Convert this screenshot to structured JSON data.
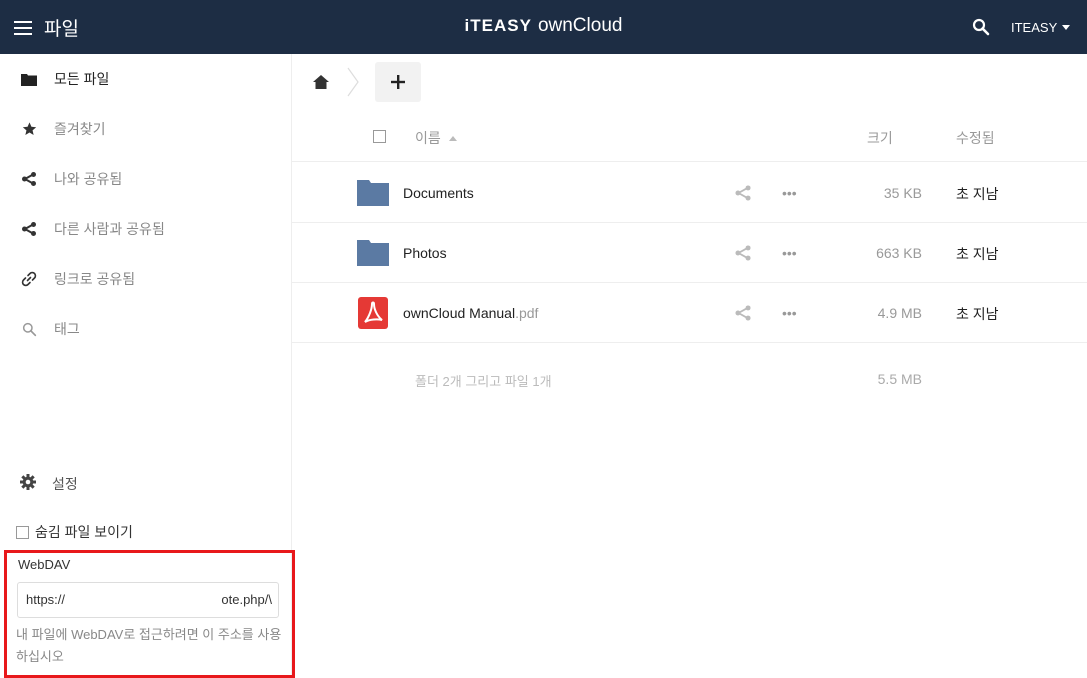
{
  "header": {
    "app_name": "파일",
    "brand_part1": "iTEASY",
    "brand_part2": "ownCloud",
    "user": "ITEASY",
    "background": "#1d2d44"
  },
  "sidebar": {
    "items": [
      {
        "label": "모든 파일",
        "icon": "folder-icon",
        "active": true
      },
      {
        "label": "즐겨찾기",
        "icon": "star-icon"
      },
      {
        "label": "나와 공유됨",
        "icon": "share-icon"
      },
      {
        "label": "다른 사람과 공유됨",
        "icon": "share-icon"
      },
      {
        "label": "링크로 공유됨",
        "icon": "link-icon"
      },
      {
        "label": "태그",
        "icon": "search-icon"
      }
    ],
    "settings_label": "설정",
    "show_hidden_label": "숨김 파일 보이기",
    "webdav": {
      "title": "WebDAV",
      "url_start": "https://",
      "url_end": "ote.php/\\",
      "hint": "내 파일에 WebDAV로 접근하려면 이 주소를 사용하십시오",
      "highlight_color": "#e8181b"
    }
  },
  "main": {
    "new_label": "+",
    "columns": {
      "name": "이름",
      "size": "크기",
      "modified": "수정됨"
    },
    "files": [
      {
        "name": "Documents",
        "ext": "",
        "type": "folder",
        "size": "35 KB",
        "modified": "초 지남"
      },
      {
        "name": "Photos",
        "ext": "",
        "type": "folder",
        "size": "663 KB",
        "modified": "초 지남"
      },
      {
        "name": "ownCloud Manual",
        "ext": ".pdf",
        "type": "pdf",
        "size": "4.9 MB",
        "modified": "초 지남"
      }
    ],
    "summary": {
      "text": "폴더 2개 그리고 파일 1개",
      "size": "5.5 MB"
    },
    "folder_color": "#5b7aa3",
    "pdf_color": "#e53935"
  }
}
